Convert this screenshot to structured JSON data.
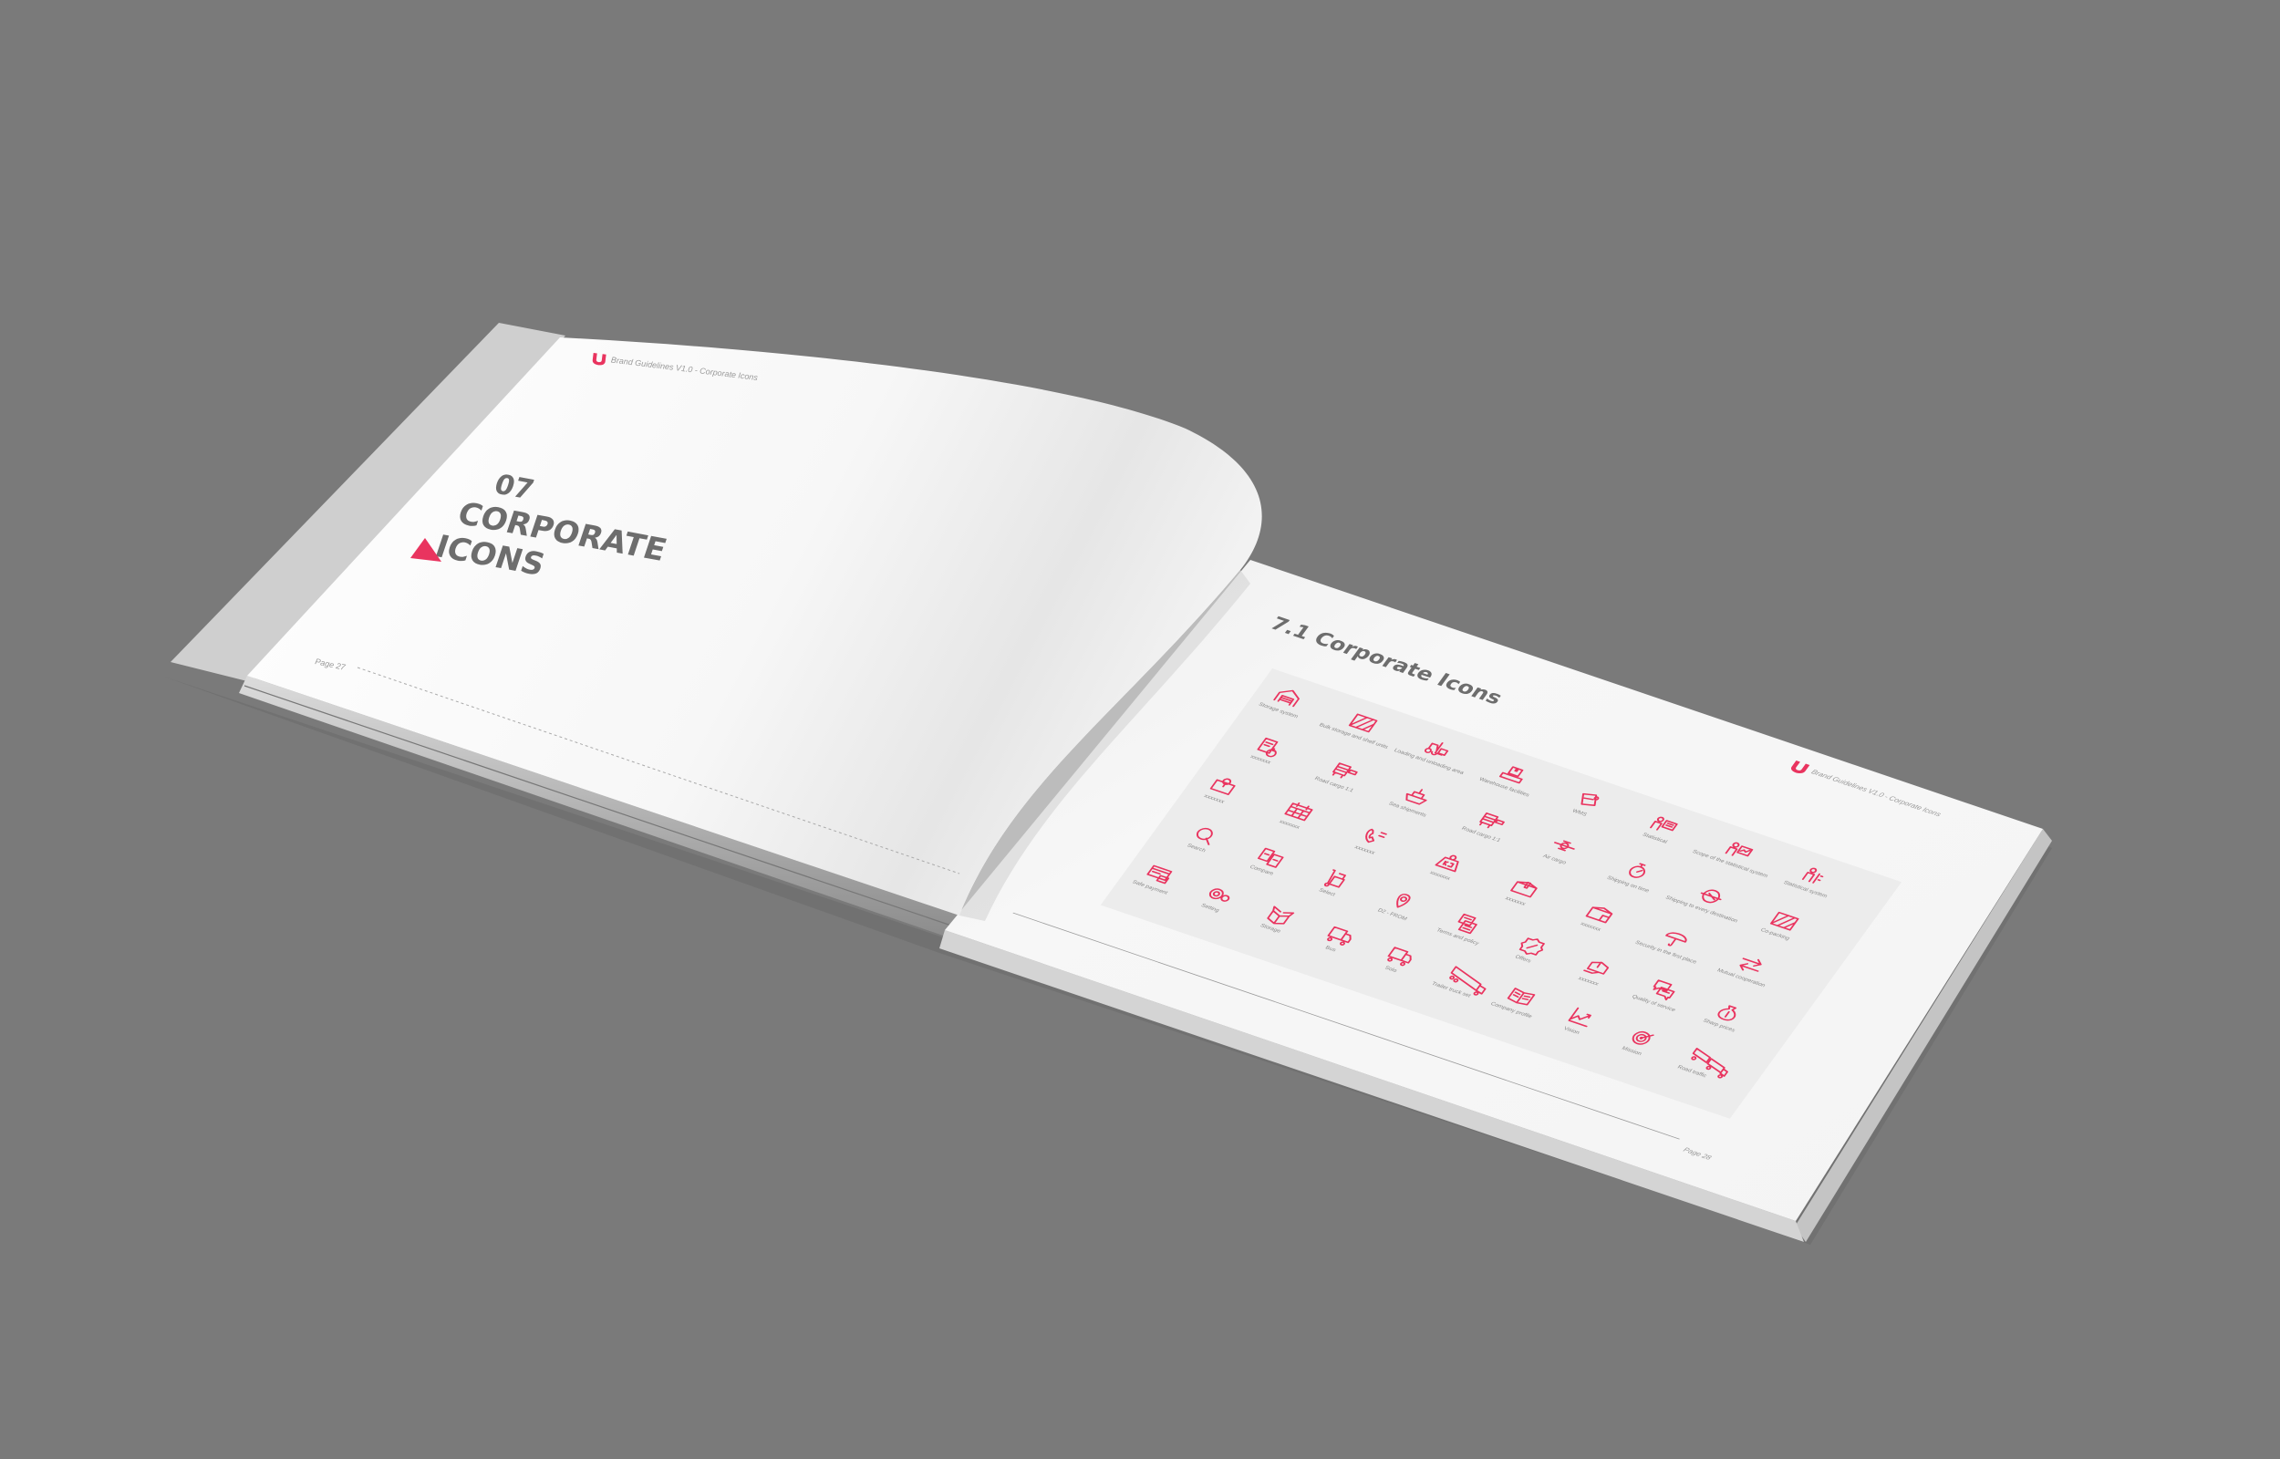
{
  "scene": {
    "background_color": "#7a7a7a",
    "accent_color": "#e9345f"
  },
  "left_page": {
    "header": "Brand Guidelines V1.0 - Corporate Icons",
    "chapter_number": "07",
    "title_line1": "CORPORATE",
    "title_line2": "ICONS",
    "page_number": "Page 27"
  },
  "right_page": {
    "header": "Brand Guidelines V1.0 - Corporate Icons",
    "section_title": "7.1 Corporate Icons",
    "page_number": "Page 28",
    "icons": [
      {
        "label": "Storage system",
        "icon": "warehouse"
      },
      {
        "label": "Bulk storage and shelf units",
        "icon": "crate"
      },
      {
        "label": "Loading and unloading area",
        "icon": "forklift"
      },
      {
        "label": "Warehouse facilities",
        "icon": "conveyor"
      },
      {
        "label": "WMS",
        "icon": "tag"
      },
      {
        "label": "Statistical",
        "icon": "person-board"
      },
      {
        "label": "Scope of the statistical system",
        "icon": "person-chart"
      },
      {
        "label": "Statistical system",
        "icon": "person"
      },
      {
        "label": "xxxxxxx",
        "icon": "clipboard-clock"
      },
      {
        "label": "Road cargo 1:1",
        "icon": "truck-front"
      },
      {
        "label": "Sea shipments",
        "icon": "ship"
      },
      {
        "label": "Road cargo 1:1",
        "icon": "truck-front"
      },
      {
        "label": "Air cargo",
        "icon": "plane"
      },
      {
        "label": "Shipping on time",
        "icon": "stopwatch"
      },
      {
        "label": "Shipping to every destination",
        "icon": "globe-plane"
      },
      {
        "label": "Co-packing",
        "icon": "crate"
      },
      {
        "label": "xxxxxxx",
        "icon": "map-pin"
      },
      {
        "label": "xxxxxxx",
        "icon": "calendar"
      },
      {
        "label": "xxxxxxx",
        "icon": "phone-24"
      },
      {
        "label": "xxxxxxx",
        "icon": "weight-kg"
      },
      {
        "label": "xxxxxxx",
        "icon": "box"
      },
      {
        "label": "xxxxxxx",
        "icon": "box-lock"
      },
      {
        "label": "Security in the first place",
        "icon": "umbrella"
      },
      {
        "label": "Mutual cooperation",
        "icon": "arrows"
      },
      {
        "label": "Search",
        "icon": "magnifier"
      },
      {
        "label": "Compare",
        "icon": "compare"
      },
      {
        "label": "Select",
        "icon": "hand-truck"
      },
      {
        "label": "D2 - FROM",
        "icon": "pin"
      },
      {
        "label": "Terms and policy",
        "icon": "document"
      },
      {
        "label": "Offers",
        "icon": "percent-badge"
      },
      {
        "label": "xxxxxxx",
        "icon": "box-hand"
      },
      {
        "label": "Quality of service",
        "icon": "chat"
      },
      {
        "label": "Sharp prices",
        "icon": "money-bag"
      },
      {
        "label": "Safe payment",
        "icon": "card-lock"
      },
      {
        "label": "Setting",
        "icon": "gears"
      },
      {
        "label": "Storage",
        "icon": "open-box"
      },
      {
        "label": "Bus",
        "icon": "truck"
      },
      {
        "label": "Solo",
        "icon": "truck"
      },
      {
        "label": "Trailer truck set",
        "icon": "trailer"
      },
      {
        "label": "Company profile",
        "icon": "book"
      },
      {
        "label": "Vision",
        "icon": "growth"
      },
      {
        "label": "Mission",
        "icon": "target"
      },
      {
        "label": "Road traffic",
        "icon": "road-train"
      }
    ]
  }
}
